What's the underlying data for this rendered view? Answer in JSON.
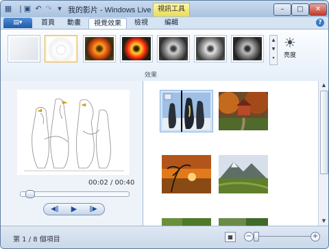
{
  "window": {
    "title": "我的影片 - Windows Live Mo...",
    "context_tab": "視訊工具",
    "controls": {
      "minimize": "–",
      "maximize": "□",
      "close": "✕"
    },
    "quick_access": {
      "film_icon": "▦",
      "save_icon": "▣",
      "undo_icon": "↶",
      "redo_icon": "↷",
      "dropdown_icon": "▾"
    }
  },
  "ribbon": {
    "app_menu_icon": "▤▾",
    "tabs": [
      {
        "label": "首頁"
      },
      {
        "label": "動畫"
      },
      {
        "label": "視覺效果"
      },
      {
        "label": "檢視"
      },
      {
        "label": "編輯"
      }
    ],
    "active_tab": "視覺效果",
    "help_icon": "?",
    "effects_group_label": "效果",
    "brightness_label": "亮度",
    "sun_icon": "☀",
    "gallery_scroll": {
      "up": "▲",
      "down": "▼",
      "more": "▾"
    },
    "effects": [
      {
        "name": "無效果"
      },
      {
        "name": "素描效果",
        "selected": true
      },
      {
        "name": "彩色效果 1"
      },
      {
        "name": "彩色效果 2"
      },
      {
        "name": "黑白效果 1"
      },
      {
        "name": "黑白效果 2"
      },
      {
        "name": "黑白效果 3"
      }
    ]
  },
  "player": {
    "time": "00:02 / 00:40",
    "progress": 0.05,
    "prev_icon": "◀‖",
    "play_icon": "▶",
    "next_icon": "‖▶"
  },
  "storyboard": {
    "thumbnails": [
      {
        "label": "penguins",
        "selected": true
      },
      {
        "label": "autumn-house"
      },
      {
        "label": "sunset-palms"
      },
      {
        "label": "mountain-valley"
      },
      {
        "label": "green-1"
      },
      {
        "label": "green-2"
      }
    ],
    "scroll_up": "▲",
    "scroll_down": "▼"
  },
  "status": {
    "text": "第 1 / 8 個項目",
    "thumbnail_icon": "▦",
    "zoom_out": "−",
    "zoom_in": "+"
  },
  "colors": {
    "accent": "#2b6cc4",
    "selected_border": "#e8b14b",
    "context_tab": "#f3e97a"
  }
}
